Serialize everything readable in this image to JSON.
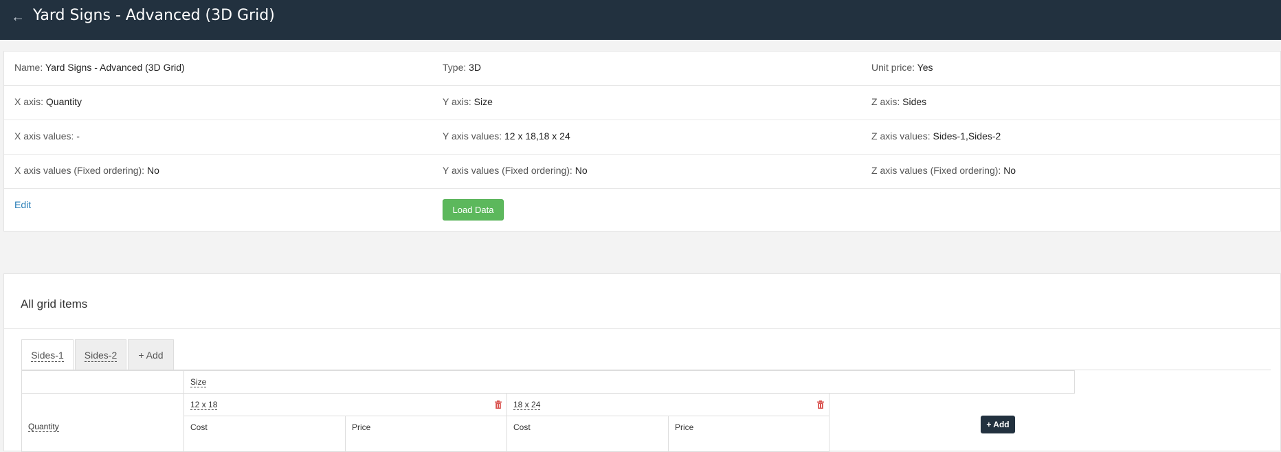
{
  "header": {
    "back_icon": "arrow-left-icon",
    "title": "Yard Signs - Advanced (3D Grid)"
  },
  "info": {
    "rows": [
      [
        {
          "key": "Name:",
          "value": "Yard Signs - Advanced (3D Grid)"
        },
        {
          "key": "Type:",
          "value": "3D"
        },
        {
          "key": "Unit price:",
          "value": "Yes"
        }
      ],
      [
        {
          "key": "X axis:",
          "value": "Quantity"
        },
        {
          "key": "Y axis:",
          "value": "Size"
        },
        {
          "key": "Z axis:",
          "value": "Sides"
        }
      ],
      [
        {
          "key": "X axis values:",
          "value": "-"
        },
        {
          "key": "Y axis values:",
          "value": "12 x 18,18 x 24"
        },
        {
          "key": "Z axis values:",
          "value": "Sides-1,Sides-2"
        }
      ],
      [
        {
          "key": "X axis values (Fixed ordering):",
          "value": "No"
        },
        {
          "key": "Y axis values (Fixed ordering):",
          "value": "No"
        },
        {
          "key": "Z axis values (Fixed ordering):",
          "value": "No"
        }
      ]
    ],
    "edit_label": "Edit",
    "load_data_label": "Load Data"
  },
  "grid": {
    "heading": "All grid items",
    "tabs": [
      "Sides-1",
      "Sides-2"
    ],
    "add_tab_label": "+ Add",
    "y_axis_label": "Size",
    "x_axis_label": "Quantity",
    "columns": [
      {
        "size": "12 x 18",
        "cost": "Cost",
        "price": "Price"
      },
      {
        "size": "18 x 24",
        "cost": "Cost",
        "price": "Price"
      }
    ],
    "add_column_label": "+ Add",
    "colors": {
      "topbar": "#22313f",
      "success": "#5cb85c",
      "danger": "#d9534f",
      "link": "#2a7fb8"
    }
  }
}
